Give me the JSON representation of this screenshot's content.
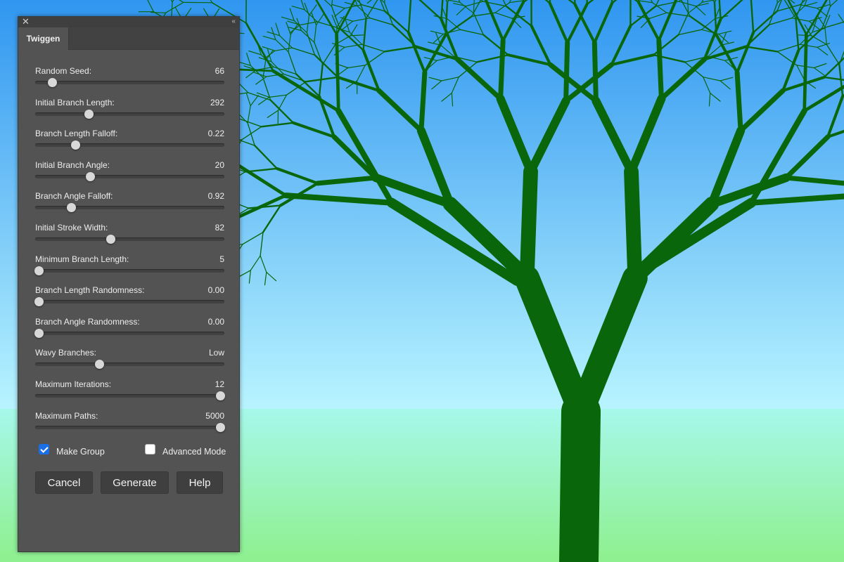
{
  "panel": {
    "tab_title": "Twiggen",
    "close_glyph": "✕",
    "collapse_glyph": "‹‹"
  },
  "controls": [
    {
      "label": "Random Seed:",
      "value": "66",
      "position": 0.09
    },
    {
      "label": "Initial Branch Length:",
      "value": "292",
      "position": 0.285
    },
    {
      "label": "Branch Length Falloff:",
      "value": "0.22",
      "position": 0.215
    },
    {
      "label": "Initial Branch Angle:",
      "value": "20",
      "position": 0.29
    },
    {
      "label": "Branch Angle Falloff:",
      "value": "0.92",
      "position": 0.19
    },
    {
      "label": "Initial Stroke Width:",
      "value": "82",
      "position": 0.4
    },
    {
      "label": "Minimum Branch Length:",
      "value": "5",
      "position": 0.02
    },
    {
      "label": "Branch Length Randomness:",
      "value": "0.00",
      "position": 0.02
    },
    {
      "label": "Branch Angle Randomness:",
      "value": "0.00",
      "position": 0.02
    },
    {
      "label": "Wavy Branches:",
      "value": "Low",
      "position": 0.34
    },
    {
      "label": "Maximum Iterations:",
      "value": "12",
      "position": 0.98
    },
    {
      "label": "Maximum Paths:",
      "value": "5000",
      "position": 0.98
    }
  ],
  "options": {
    "make_group": {
      "label": "Make Group",
      "checked": true
    },
    "advanced_mode": {
      "label": "Advanced Mode",
      "checked": false
    }
  },
  "buttons": {
    "cancel": "Cancel",
    "generate": "Generate",
    "help": "Help"
  },
  "colors": {
    "sky_top": "#3096f0",
    "sky_horizon": "#b8f4ff",
    "ground_top": "#a6f8ea",
    "ground_bottom": "#8ef08e",
    "tree": "#0a660a",
    "checkbox_accent": "#1a6fe6"
  }
}
